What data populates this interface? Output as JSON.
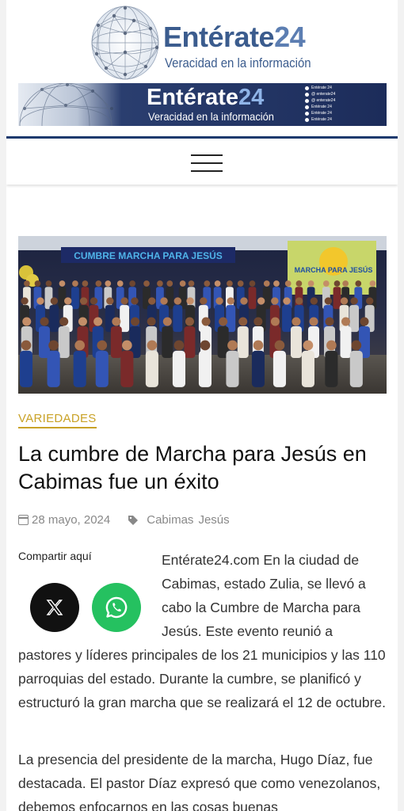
{
  "header": {
    "logo_title": "Entérate",
    "logo_number": "24",
    "logo_tagline": "Veracidad en la información",
    "banner_title": "Entérate",
    "banner_number": "24",
    "banner_tagline": "Veracidad en la información",
    "socials": [
      {
        "icon": "facebook-icon",
        "label": "Entérate 24"
      },
      {
        "icon": "twitter-icon",
        "label": "@ enterate24"
      },
      {
        "icon": "instagram-icon",
        "label": "@ enterate24"
      },
      {
        "icon": "telegram-icon",
        "label": "Entérate 24"
      },
      {
        "icon": "tiktok-icon",
        "label": "Entérate 24"
      },
      {
        "icon": "youtube-icon",
        "label": "Entérate 24"
      }
    ],
    "brand_color": "#1d3a6e",
    "menu_icon": "hamburger-menu-icon"
  },
  "article": {
    "category": "VARIEDADES",
    "category_color": "#c9a227",
    "title": "La cumbre de Marcha para Jesús en Cabimas fue un éxito",
    "date": "28 mayo, 2024",
    "tags": [
      "Cabimas",
      "Jesús"
    ],
    "share_label": "Compartir aquí",
    "share_buttons": [
      {
        "icon": "x-twitter-icon",
        "color": "#111111"
      },
      {
        "icon": "whatsapp-icon",
        "color": "#25c160"
      }
    ],
    "image_banner_text": "CUMBRE MARCHA PARA JESÚS",
    "image_screen_text": "MARCHA PARA JESÚS",
    "paragraph1_lead": "Entérate24.com En la ciudad de Cabimas, estado Zulia, se llevó a cabo la Cumbre de Marcha para Jesús. Este evento reunió a",
    "paragraph1_rest": "pastores y líderes principales de los 21 municipios y las 110 parroquias del estado. Durante la cumbre, se planificó y estructuró la gran marcha que se realizará el 12 de octubre.",
    "paragraph2": "La presencia del presidente de la marcha, Hugo Díaz, fue destacada. El pastor Díaz expresó que como venezolanos, debemos enfocarnos en las cosas buenas"
  }
}
